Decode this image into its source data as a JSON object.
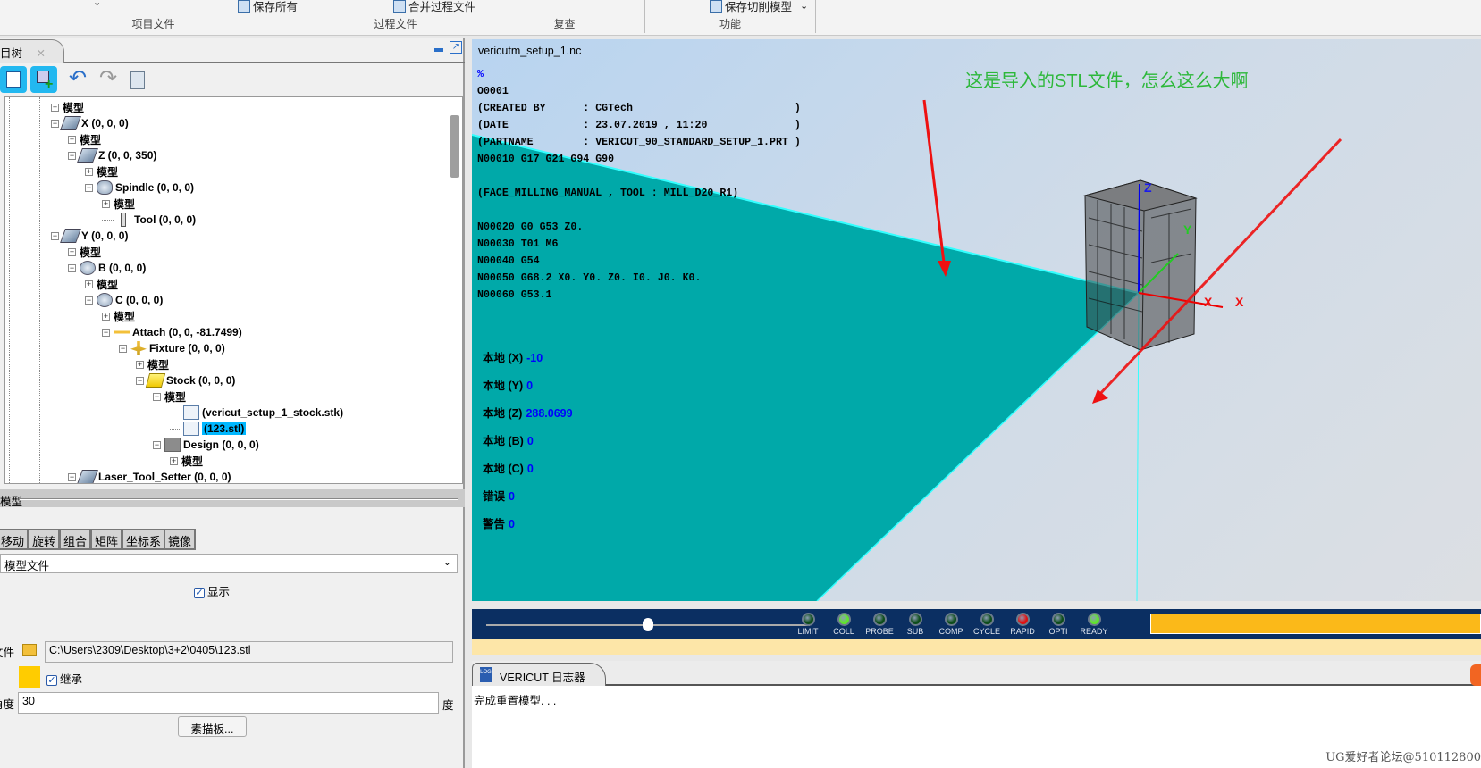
{
  "ribbon": {
    "groups": [
      {
        "label": "项目文件"
      },
      {
        "label": "过程文件"
      },
      {
        "label": "复查"
      },
      {
        "label": "功能"
      }
    ],
    "buttons": {
      "save_all": "保存所有",
      "merge_process": "合并过程文件",
      "save_cut_model": "保存切削模型"
    }
  },
  "left_panel": {
    "tab_label": "目树",
    "tree": [
      {
        "label": "模型",
        "level": 0,
        "exp": "+",
        "icon": "model"
      },
      {
        "label": "X (0, 0, 0)",
        "level": 0,
        "exp": "-",
        "icon": "linear-axis"
      },
      {
        "label": "模型",
        "level": 1,
        "exp": "+",
        "icon": "model"
      },
      {
        "label": "Z (0, 0, 350)",
        "level": 1,
        "exp": "-",
        "icon": "linear-axis"
      },
      {
        "label": "模型",
        "level": 2,
        "exp": "+",
        "icon": "model"
      },
      {
        "label": "Spindle (0, 0, 0)",
        "level": 2,
        "exp": "-",
        "icon": "spindle"
      },
      {
        "label": "模型",
        "level": 3,
        "exp": "+",
        "icon": "model"
      },
      {
        "label": "Tool (0, 0, 0)",
        "level": 3,
        "exp": "",
        "icon": "tool"
      },
      {
        "label": "Y (0, 0, 0)",
        "level": 0,
        "exp": "-",
        "icon": "linear-axis"
      },
      {
        "label": "模型",
        "level": 1,
        "exp": "+",
        "icon": "model"
      },
      {
        "label": "B (0, 0, 0)",
        "level": 1,
        "exp": "-",
        "icon": "rotary-axis"
      },
      {
        "label": "模型",
        "level": 2,
        "exp": "+",
        "icon": "model"
      },
      {
        "label": "C (0, 0, 0)",
        "level": 2,
        "exp": "-",
        "icon": "rotary-axis"
      },
      {
        "label": "模型",
        "level": 3,
        "exp": "+",
        "icon": "model"
      },
      {
        "label": "Attach (0, 0, -81.7499)",
        "level": 3,
        "exp": "-",
        "icon": "attach"
      },
      {
        "label": "Fixture (0, 0, 0)",
        "level": 4,
        "exp": "-",
        "icon": "fixture"
      },
      {
        "label": "模型",
        "level": 5,
        "exp": "+",
        "icon": "model"
      },
      {
        "label": "Stock (0, 0, 0)",
        "level": 5,
        "exp": "-",
        "icon": "stock"
      },
      {
        "label": "模型",
        "level": 6,
        "exp": "-",
        "icon": "model"
      },
      {
        "label": "(vericut_setup_1_stock.stk)",
        "level": 7,
        "exp": "",
        "icon": "file"
      },
      {
        "label": "(123.stl)",
        "level": 7,
        "exp": "",
        "icon": "file",
        "selected": true
      },
      {
        "label": "Design (0, 0, 0)",
        "level": 6,
        "exp": "-",
        "icon": "design"
      },
      {
        "label": "模型",
        "level": 7,
        "exp": "+",
        "icon": "model"
      },
      {
        "label": "Laser_Tool_Setter (0, 0, 0)",
        "level": 1,
        "exp": "-",
        "icon": "linear-axis"
      }
    ],
    "model_section": {
      "title": "模型",
      "tabs": [
        "移动",
        "旋转",
        "组合",
        "矩阵",
        "坐标系",
        "镜像"
      ],
      "type_select": "模型文件",
      "show_label": "显示",
      "show_checked": true,
      "file_label": "文件",
      "file_path": "C:\\Users\\2309\\Desktop\\3+2\\0405\\123.stl",
      "color": "#ffcc00",
      "inherit_label": "继承",
      "inherit_checked": true,
      "angle_label": "角度",
      "angle_value": "30",
      "angle_unit": "度",
      "sketch_button": "素描板..."
    }
  },
  "viewport": {
    "nc_file": "vericutm_setup_1.nc",
    "nc_lines": [
      "%",
      "O0001",
      "(CREATED BY      : CGTech                          )",
      "(DATE            : 23.07.2019 , 11:20              )",
      "(PARTNAME        : VERICUT_90_STANDARD_SETUP_1.PRT )",
      "N00010 G17 G21 G94 G90",
      "",
      "(FACE_MILLING_MANUAL , TOOL : MILL_D20_R1)",
      "",
      "N00020 G0 G53 Z0.",
      "N00030 T01 M6",
      "N00040 G54",
      "N00050 G68.2 X0. Y0. Z0. I0. J0. K0.",
      "N00060 G53.1"
    ],
    "readouts": [
      {
        "label": "本地 (X)",
        "value": "-10"
      },
      {
        "label": "本地 (Y)",
        "value": "0"
      },
      {
        "label": "本地 (Z)",
        "value": "288.0699"
      },
      {
        "label": "本地 (B)",
        "value": "0"
      },
      {
        "label": "本地 (C)",
        "value": "0"
      },
      {
        "label": "错误",
        "value": "0"
      },
      {
        "label": "警告",
        "value": "0"
      }
    ],
    "annotation": "这是导入的STL文件，怎么这么大啊",
    "axis_labels": {
      "z": "Z",
      "y": "Y",
      "x1": "X",
      "x2": "X"
    }
  },
  "status": {
    "slider_value": 0.5,
    "lights": [
      {
        "label": "LIMIT",
        "color": "#0d4d1a"
      },
      {
        "label": "COLL",
        "color": "#5ee62a"
      },
      {
        "label": "PROBE",
        "color": "#0d4d1a"
      },
      {
        "label": "SUB",
        "color": "#0d4d1a"
      },
      {
        "label": "COMP",
        "color": "#0d4d1a"
      },
      {
        "label": "CYCLE",
        "color": "#0d4d1a"
      },
      {
        "label": "RAPID",
        "color": "#e01010"
      },
      {
        "label": "OPTI",
        "color": "#0d4d1a"
      },
      {
        "label": "READY",
        "color": "#5ee62a"
      }
    ],
    "progress_color": "#fbb919"
  },
  "log": {
    "tab_label": "VERICUT 日志器",
    "message": "完成重置模型. . ."
  },
  "watermark": "UG爱好者论坛@510112800"
}
